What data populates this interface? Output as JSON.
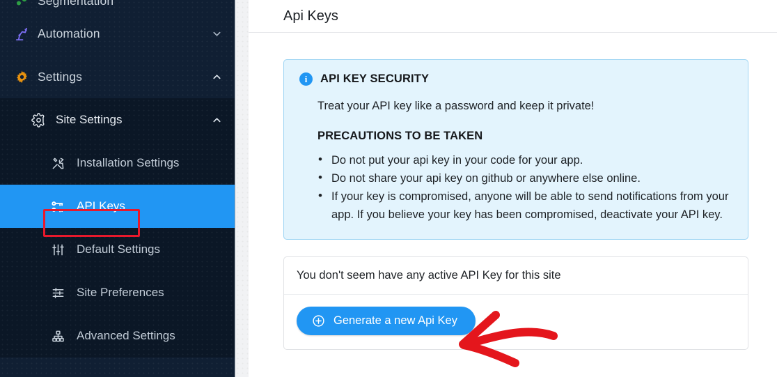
{
  "sidebar": {
    "items": [
      {
        "label": "Segmentation",
        "icon": "segmentation-icon",
        "chevron": ""
      },
      {
        "label": "Automation",
        "icon": "automation-robot-icon",
        "chevron": "chevron-down-icon"
      },
      {
        "label": "Settings",
        "icon": "gear-solid-icon",
        "chevron": "chevron-up-icon"
      }
    ],
    "submenu_head": {
      "label": "Site Settings",
      "icon": "gear-outline-icon",
      "chevron": "chevron-up-icon"
    },
    "subitems": [
      {
        "label": "Installation Settings",
        "icon": "tools-icon",
        "active": false
      },
      {
        "label": "API Keys",
        "icon": "keys-icon",
        "active": true
      },
      {
        "label": "Default Settings",
        "icon": "sliders-vertical-icon",
        "active": false
      },
      {
        "label": "Site Preferences",
        "icon": "sliders-horizontal-icon",
        "active": false
      },
      {
        "label": "Advanced Settings",
        "icon": "hierarchy-icon",
        "active": false
      }
    ]
  },
  "header": {
    "title": "Api Keys"
  },
  "alert": {
    "icon": "info-icon",
    "title": "API KEY SECURITY",
    "text": "Treat your API key like a password and keep it private!",
    "subtitle": "PRECAUTIONS TO BE TAKEN",
    "bullets": [
      "Do not put your api key in your code for your app.",
      "Do not share your api key on github or anywhere else online.",
      "If your key is compromised, anyone will be able to send notifications from your app. If you believe your key has been compromised, deactivate your API key."
    ]
  },
  "card": {
    "message": "You don't seem have any active API Key for this site",
    "button_label": "Generate a new Api Key",
    "button_icon": "plus-circle-icon"
  },
  "annotations": {
    "highlight_color": "#e8192c",
    "arrow_color": "#e4161c",
    "accent_color": "#2196f3"
  }
}
